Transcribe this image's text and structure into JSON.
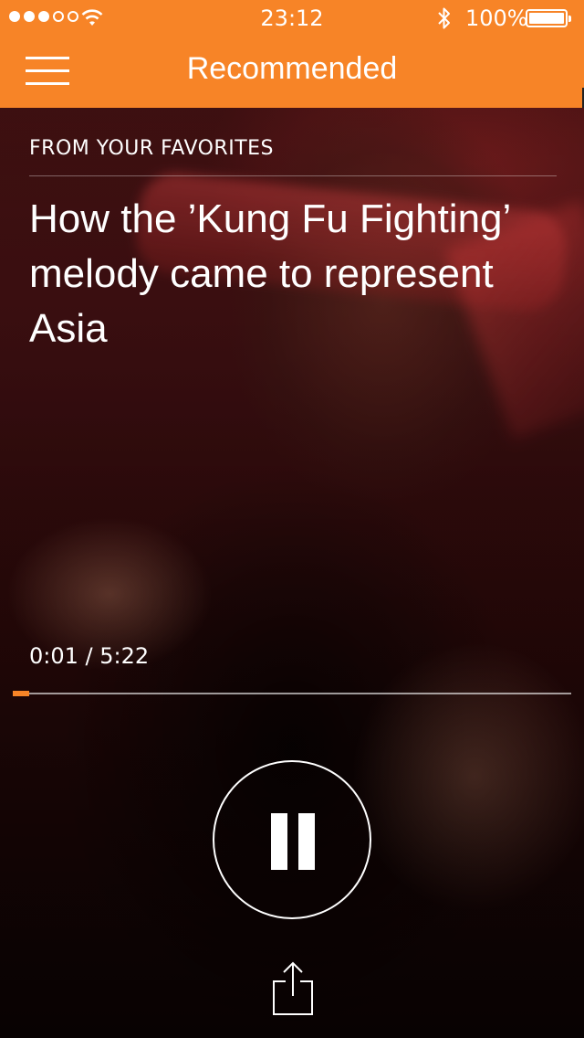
{
  "status_bar": {
    "signal_dots": {
      "filled": 3,
      "total": 5
    },
    "wifi_icon": "wifi-icon",
    "time": "23:12",
    "bluetooth_icon": "bluetooth-icon",
    "battery_percent": "100%",
    "battery_level": 1.0
  },
  "nav": {
    "menu_icon": "hamburger-menu-icon",
    "title": "Recommended",
    "bar_color": "#f78427"
  },
  "story": {
    "section_label": "FROM YOUR FAVORITES",
    "title": "How the ’Kung Fu Fighting’ melody came to represent Asia"
  },
  "player": {
    "elapsed": "0:01",
    "separator": "/",
    "duration": "5:22",
    "progress_fraction": 0.003,
    "accent_color": "#f78427",
    "pause_icon": "pause-icon",
    "share_icon": "share-icon"
  }
}
